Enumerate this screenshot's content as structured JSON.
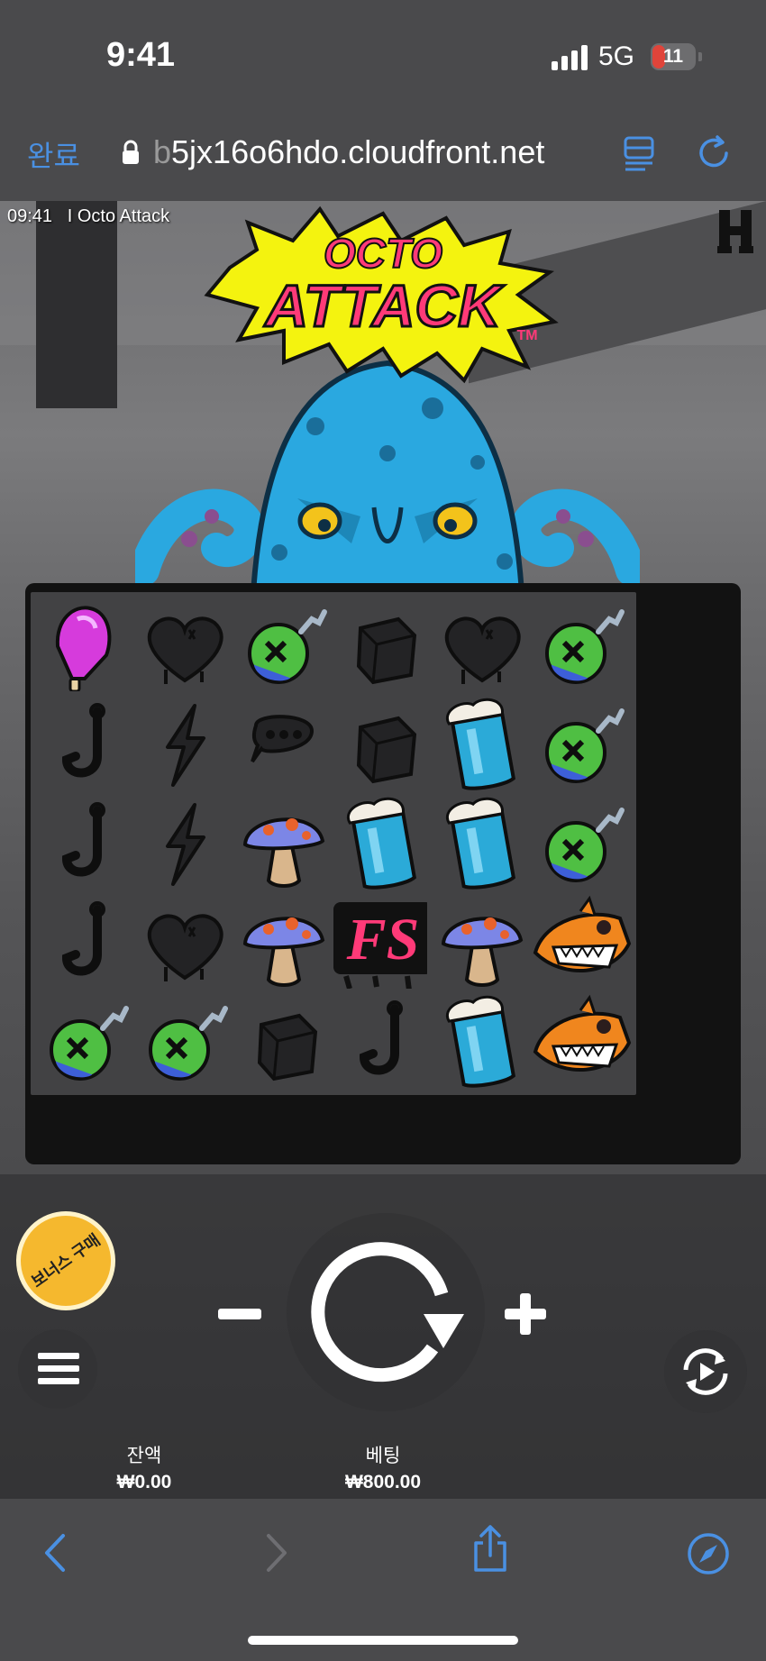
{
  "status_bar": {
    "time": "9:41",
    "network": "5G",
    "battery": "11"
  },
  "browser": {
    "done_label": "완료",
    "url_prefix": "b",
    "url_main": "5jx16o6hdo.cloudfront.net"
  },
  "game": {
    "clock": "09:41",
    "separator": "I",
    "title": "Octo Attack",
    "logo_line1": "OCTO",
    "logo_line2": "ATTACK",
    "logo_tm": "TM",
    "bonus_label": "보너스 구매",
    "balance_label": "잔액",
    "balance_value": "₩0.00",
    "bet_label": "베팅",
    "bet_value": "₩800.00",
    "reels": [
      [
        "popsicle",
        "heart",
        "bomb-fish",
        "cube",
        "heart",
        "bomb-fish"
      ],
      [
        "hook",
        "bolt",
        "speech",
        "cube",
        "can",
        "bomb-fish"
      ],
      [
        "hook",
        "bolt",
        "mushroom",
        "can",
        "can",
        "bomb-fish"
      ],
      [
        "hook",
        "heart",
        "mushroom",
        "fs-scatter",
        "mushroom",
        "shark"
      ],
      [
        "bomb-fish",
        "bomb-fish",
        "cube",
        "hook",
        "can",
        "shark"
      ]
    ],
    "fs_text": "FS"
  },
  "colors": {
    "accent": "#4a90e2",
    "bonus": "#f5b82e",
    "logo_pink": "#ff3a78",
    "logo_yellow": "#f4f30f",
    "octopus": "#2aa8e0"
  }
}
